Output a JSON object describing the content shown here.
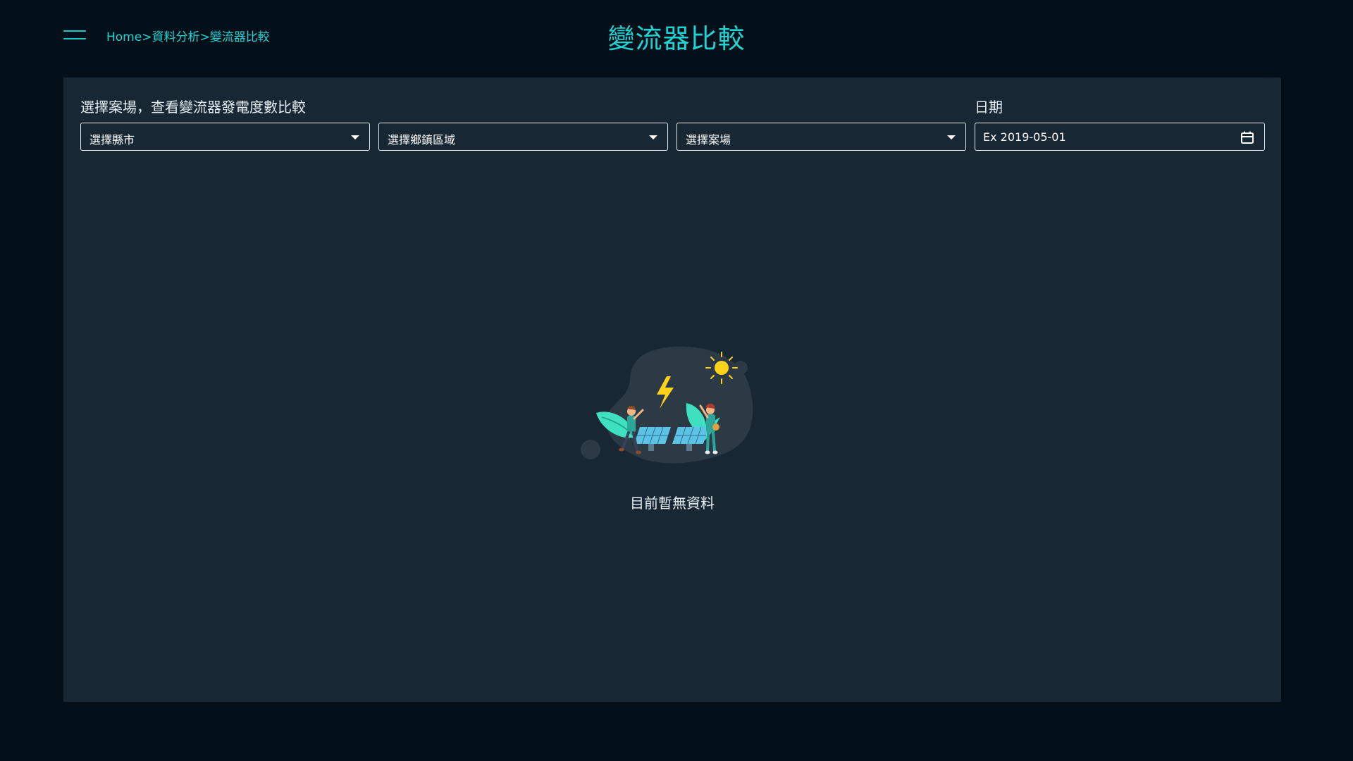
{
  "header": {
    "menu_icon": "hamburger-menu-icon",
    "breadcrumb": {
      "home": "Home",
      "separator": ">",
      "section": "資料分析",
      "current": "變流器比較"
    },
    "title": "變流器比較"
  },
  "filters": {
    "heading": "選擇案場，查看變流器發電度數比較",
    "city_select": {
      "value": "選擇縣市",
      "icon": "caret-down-icon"
    },
    "district_select": {
      "value": "選擇鄉鎮區域",
      "icon": "caret-down-icon"
    },
    "site_select": {
      "value": "選擇案場",
      "icon": "caret-down-icon"
    },
    "date": {
      "label": "日期",
      "placeholder": "Ex 2019-05-01",
      "value": "",
      "icon": "calendar-icon"
    }
  },
  "empty_state": {
    "illustration": "solar-panels-empty-illustration",
    "message": "目前暫無資料"
  },
  "colors": {
    "background": "#031019",
    "panel": "#172733",
    "accent": "#1ed3d3",
    "text": "#e6edf1"
  }
}
